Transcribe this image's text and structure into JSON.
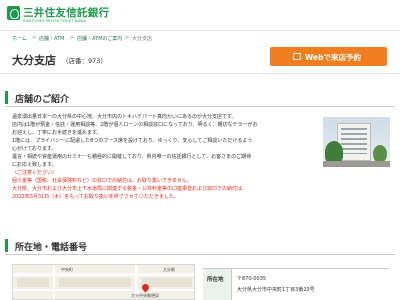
{
  "header": {
    "logo_jp": "三井住友信託銀行",
    "logo_en": "SUMITOMO MITSUI TRUST BANK"
  },
  "breadcrumb": {
    "home": "ホーム",
    "sep": ">",
    "stores": "店舗・ATM",
    "stores_guide": "店舗・ATMのご案内",
    "current": "大分支店"
  },
  "page": {
    "title": "大分支店",
    "code": "（店番：973）",
    "web_button": "Webで来店予約"
  },
  "intro": {
    "heading": "店舗のご紹介",
    "lines": [
      "温泉湧出量日本一の大分県の中心地、大分市内のトキハデパート真向かいにあるのが大分支店です。",
      "店内は1階が預金・信託・運用相談等、2階が個人ローンの相談窓口になっており、明るく、親切なテラーがお",
      "お迎えし、丁寧にお手続きを進めます。",
      "1階には、プライバシーに配慮した8つのブース席を設けており、ゆっくり、安心してご相談いただけるよう",
      "心がけております。",
      "遺言・相続や資産運用のセミナーも積極的に開催しており、県内唯一の信託銀行として、お客さまのご期待",
      "にお応え致します。"
    ],
    "notice_lines": [
      "（ご注意ください）",
      "個人金等（国税、社会保険料など）の窓口での納付は、お取り扱いできません。",
      "大分県、大分市および大分市上下水道局に関連する税金・公共料金等の口座振替および窓口での納付は、",
      "2022年3月31日（木）をもってお取り扱いを終了させていただきました。"
    ]
  },
  "access": {
    "heading": "所在地・電話番号",
    "address_label": "所在地",
    "zip": "〒870-0035",
    "address": "大分県大分市中央町1丁目3番23号",
    "map_labels": [
      "中央町",
      "大分中央郵便局",
      "大分駅"
    ]
  },
  "colors": {
    "brand_green": "#1a9b4e",
    "cta_orange": "#f07e1e",
    "notice_red": "#e0261b"
  },
  "icons": {
    "logo": "smbc-trust-logo-icon",
    "reserve": "calendar-icon",
    "map_pin": "map-pin-icon"
  }
}
